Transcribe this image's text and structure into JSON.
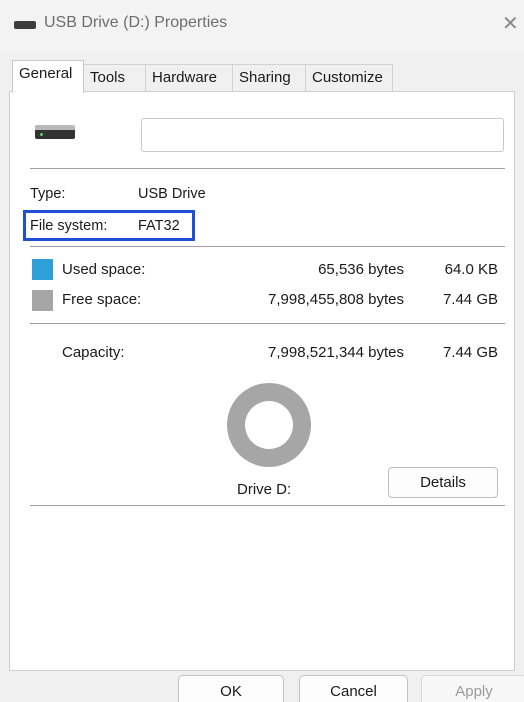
{
  "window": {
    "title": "USB Drive (D:) Properties",
    "close_glyph": "✕"
  },
  "tabs": [
    "General",
    "Tools",
    "Hardware",
    "Sharing",
    "Customize"
  ],
  "general": {
    "name_value": "",
    "type_label": "Type:",
    "type_value": "USB Drive",
    "fs_label": "File system:",
    "fs_value": "FAT32",
    "used_label": "Used space:",
    "used_bytes": "65,536 bytes",
    "used_size": "64.0 KB",
    "free_label": "Free space:",
    "free_bytes": "7,998,455,808 bytes",
    "free_size": "7.44 GB",
    "capacity_label": "Capacity:",
    "capacity_bytes": "7,998,521,344 bytes",
    "capacity_size": "7.44 GB",
    "drive_label": "Drive D:",
    "details_label": "Details",
    "used_fraction": 8.2e-06
  },
  "colors": {
    "used": "#2e9fd8",
    "free": "#a6a6a6",
    "highlight": "#1f4fd8"
  },
  "buttons": {
    "ok": "OK",
    "cancel": "Cancel",
    "apply": "Apply"
  }
}
